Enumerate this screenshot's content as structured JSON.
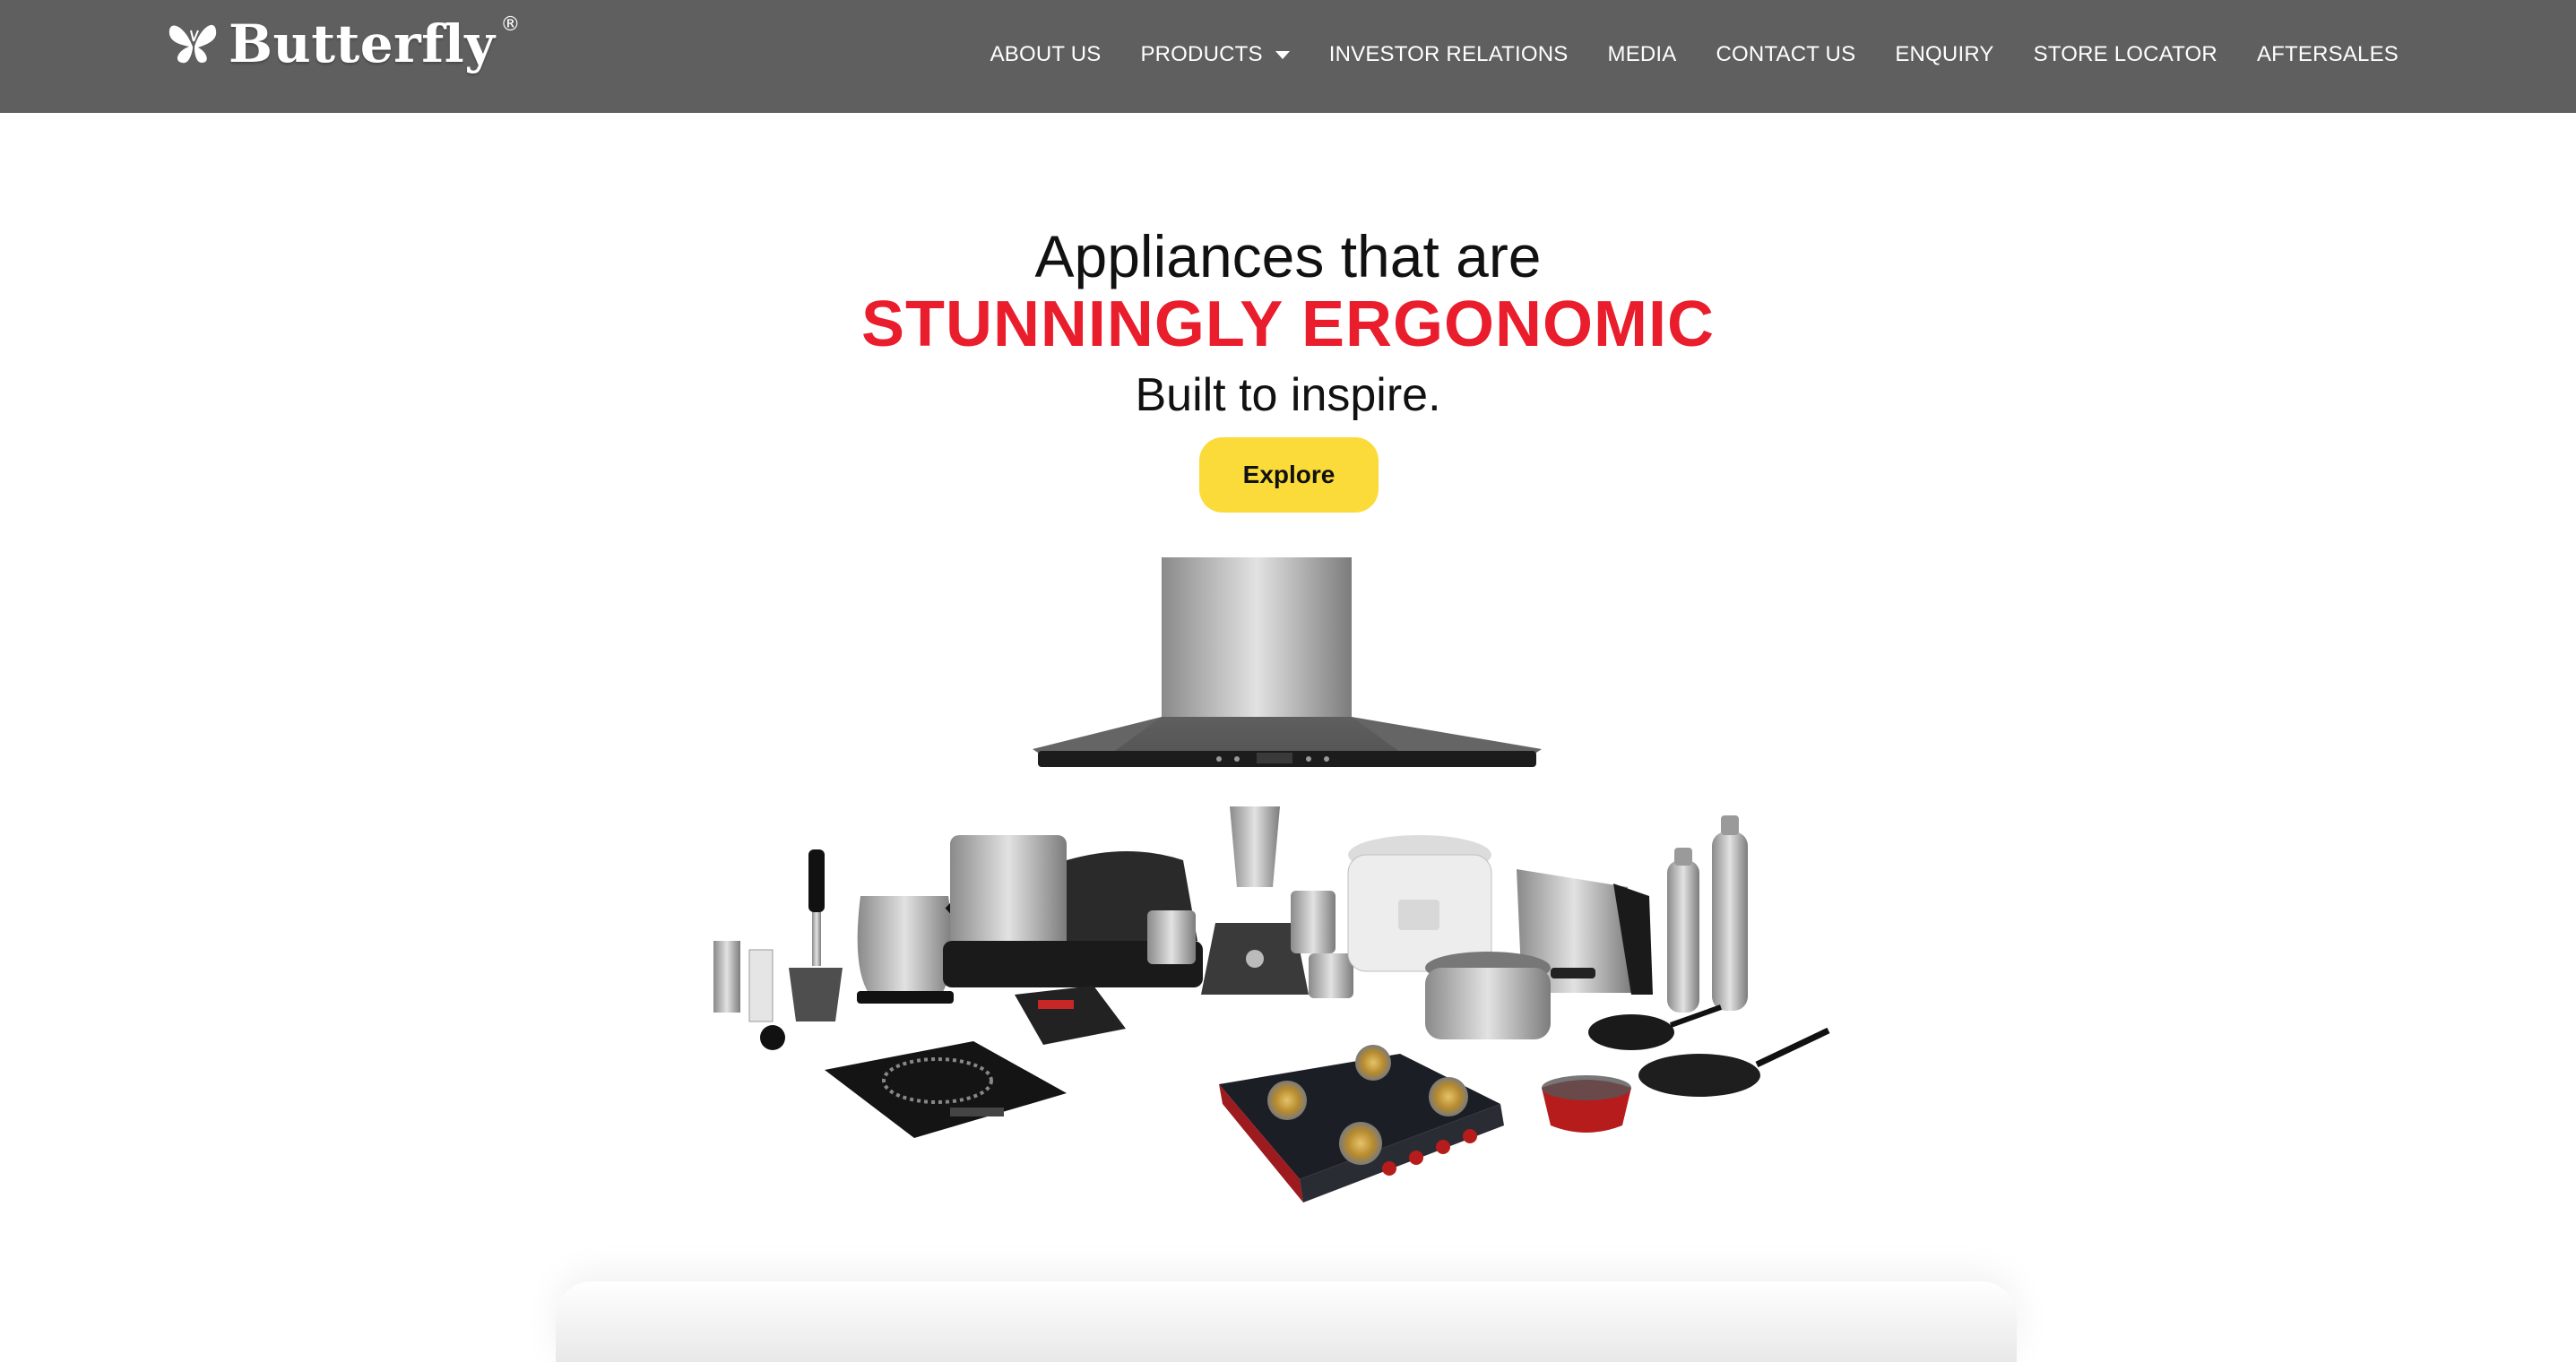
{
  "header": {
    "logo": {
      "name": "Butterfly",
      "reg": "®"
    },
    "nav": [
      {
        "label": "ABOUT US"
      },
      {
        "label": "PRODUCTS",
        "has_dropdown": true
      },
      {
        "label": "INVESTOR RELATIONS"
      },
      {
        "label": "MEDIA"
      },
      {
        "label": "CONTACT US"
      },
      {
        "label": "ENQUIRY"
      },
      {
        "label": "STORE LOCATOR"
      },
      {
        "label": "AFTERSALES"
      }
    ]
  },
  "hero": {
    "line1": "Appliances that are",
    "line2": "STUNNINGLY ERGONOMIC",
    "line3": "Built to inspire.",
    "cta": "Explore"
  },
  "colors": {
    "header_bg": "#5f5f5f",
    "accent_red": "#ea1d2c",
    "button_yellow": "#fbdb3a"
  },
  "icons": [
    "butterfly-logo-icon",
    "chevron-down-icon"
  ]
}
